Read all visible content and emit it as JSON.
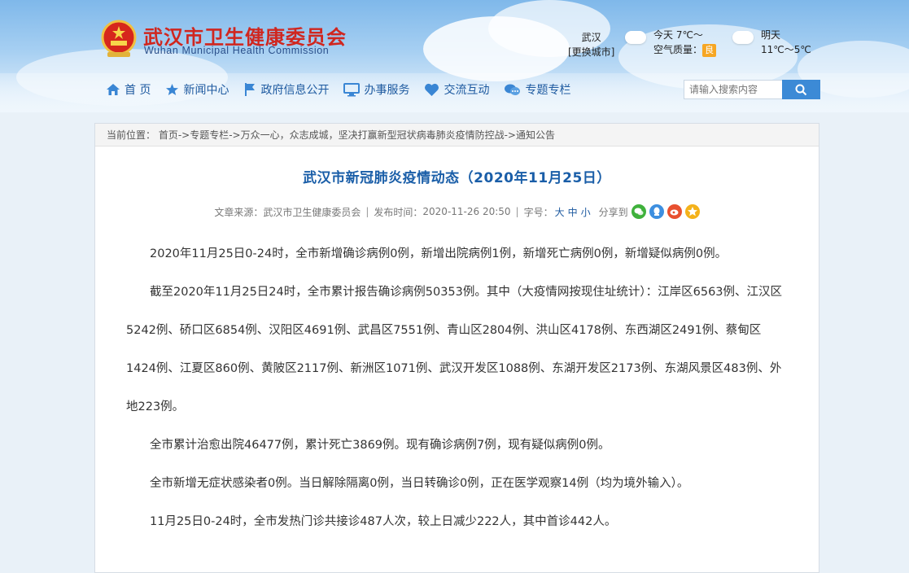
{
  "header": {
    "title": "武汉市卫生健康委员会",
    "subtitle": "Wuhan Municipal Health Commission"
  },
  "weather": {
    "city": "武汉",
    "change_city": "[更换城市]",
    "today_label": "今天 7℃～",
    "air_quality_label": "空气质量：",
    "air_quality_value": "良",
    "tomorrow_label": "明天",
    "tomorrow_temp": "11℃～5℃"
  },
  "nav": {
    "items": [
      {
        "label": "首 页",
        "icon": "home-icon"
      },
      {
        "label": "新闻中心",
        "icon": "star-icon"
      },
      {
        "label": "政府信息公开",
        "icon": "flag-icon"
      },
      {
        "label": "办事服务",
        "icon": "monitor-icon"
      },
      {
        "label": "交流互动",
        "icon": "heart-icon"
      },
      {
        "label": "专题专栏",
        "icon": "chat-icon"
      }
    ]
  },
  "search": {
    "placeholder": "请输入搜索内容",
    "icon": "search-icon"
  },
  "breadcrumb": {
    "text": "当前位置： 首页->专题专栏->万众一心，众志成城，坚决打赢新型冠状病毒肺炎疫情防控战->通知公告"
  },
  "article": {
    "title": "武汉市新冠肺炎疫情动态（2020年11月25日）",
    "source_label": "文章来源：",
    "source_value": "武汉市卫生健康委员会",
    "sep1": "|",
    "publish_label": "发布时间：",
    "publish_value": "2020-11-26 20:50",
    "sep2": "|",
    "font_label": "字号：",
    "font_large": "大",
    "font_medium": "中",
    "font_small": "小",
    "share_label": "分享到",
    "share_icons": [
      "wechat-icon",
      "qq-icon",
      "weibo-icon",
      "qzone-icon"
    ],
    "share_colors": [
      "#3fb13c",
      "#3d8fe0",
      "#e8502f",
      "#f4b21b"
    ],
    "paragraphs": [
      "2020年11月25日0-24时，全市新增确诊病例0例，新增出院病例1例，新增死亡病例0例，新增疑似病例0例。",
      "截至2020年11月25日24时，全市累计报告确诊病例50353例。其中（大疫情网按现住址统计）：江岸区6563例、江汉区5242例、硚口区6854例、汉阳区4691例、武昌区7551例、青山区2804例、洪山区4178例、东西湖区2491例、蔡甸区1424例、江夏区860例、黄陂区2117例、新洲区1071例、武汉开发区1088例、东湖开发区2173例、东湖风景区483例、外地223例。",
      "全市累计治愈出院46477例，累计死亡3869例。现有确诊病例7例，现有疑似病例0例。",
      "全市新增无症状感染者0例。当日解除隔离0例，当日转确诊0例，正在医学观察14例（均为境外输入）。",
      "11月25日0-24时，全市发热门诊共接诊487人次，较上日减少222人，其中首诊442人。"
    ]
  }
}
